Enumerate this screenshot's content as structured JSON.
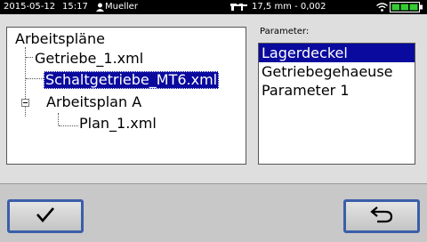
{
  "status": {
    "date": "2015-05-12",
    "time": "15:17",
    "user": "Mueller",
    "measurement": "17,5 mm - 0,002",
    "battery_color": "#33cc33"
  },
  "tree": {
    "root": "Arbeitspläne",
    "items": [
      "Getriebe_1.xml",
      "Schaltgetriebe_MT6.xml",
      "Arbeitsplan A",
      "Plan_1.xml"
    ]
  },
  "params": {
    "label": "Parameter:",
    "items": [
      "Lagerdeckel",
      "Getriebegehaeuse",
      "Parameter 1"
    ]
  },
  "icons": {
    "user": "user-icon",
    "caliper": "caliper-icon",
    "wifi": "wifi-icon",
    "battery": "battery-icon",
    "confirm": "checkmark-icon",
    "back": "return-arrow-icon",
    "collapse": "minus-expander-icon"
  },
  "colors": {
    "selection": "#0a0a9e",
    "button_border": "#3a5fa8"
  }
}
